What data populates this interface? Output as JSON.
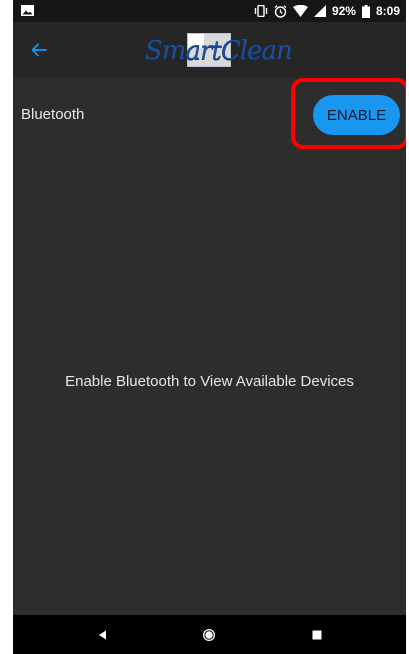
{
  "status_bar": {
    "battery": "92%",
    "time": "8:09"
  },
  "app_bar": {
    "logo_text": "SmartClean"
  },
  "bluetooth_row": {
    "label": "Bluetooth",
    "enable_button": "ENABLE"
  },
  "main": {
    "empty_message": "Enable Bluetooth to View Available Devices"
  },
  "colors": {
    "accent": "#1996f0",
    "background": "#2d2d2d",
    "highlight": "#ff0000",
    "logo": "#1d4f9a"
  },
  "icons": {
    "back": "arrow-left-icon",
    "nav_back": "triangle-back-icon",
    "nav_home": "circle-home-icon",
    "nav_recents": "square-recents-icon"
  }
}
